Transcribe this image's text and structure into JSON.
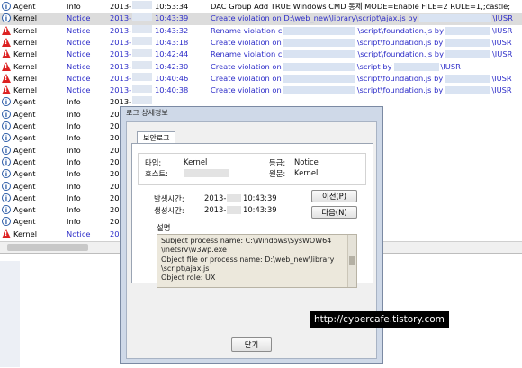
{
  "rows": [
    {
      "type": "info",
      "source": "Agent",
      "level": "Info",
      "date": "2013-",
      "time": "10:53:34",
      "desc": "DAC Group Add TRUE Windows CMD 통제 MODE=Enable FILE=2 RULE=1,;castle;",
      "sel": false
    },
    {
      "type": "info",
      "source": "Kernel",
      "level": "Notice",
      "date": "2013-",
      "time": "10:43:39",
      "desc": "Create violation on D:\\web_new\\library\\script\\ajax.js by",
      "tail": "\\IUSR",
      "sel": true
    },
    {
      "type": "warn",
      "source": "Kernel",
      "level": "Notice",
      "date": "2013-",
      "time": "10:43:32",
      "desc": "Rename violation c",
      "tail": "\\script\\foundation.js by",
      "tail2": "\\IUSR",
      "sel": false
    },
    {
      "type": "warn",
      "source": "Kernel",
      "level": "Notice",
      "date": "2013-",
      "time": "10:43:18",
      "desc": "Create violation on",
      "tail": "\\script\\foundation.js by",
      "tail2": "\\IUSR",
      "sel": false
    },
    {
      "type": "warn",
      "source": "Kernel",
      "level": "Notice",
      "date": "2013-",
      "time": "10:42:44",
      "desc": "Rename violation c",
      "tail": "\\script\\foundation.js by",
      "tail2": "\\IUSR",
      "sel": false
    },
    {
      "type": "warn",
      "source": "Kernel",
      "level": "Notice",
      "date": "2013-",
      "time": "10:42:30",
      "desc": "Create violation on",
      "tail": "\\script by",
      "tail2": "\\IUSR",
      "sel": false
    },
    {
      "type": "warn",
      "source": "Kernel",
      "level": "Notice",
      "date": "2013-",
      "time": "10:40:46",
      "desc": "Create violation on",
      "tail": "\\script\\foundation.js by",
      "tail2": "\\IUSR",
      "sel": false
    },
    {
      "type": "warn",
      "source": "Kernel",
      "level": "Notice",
      "date": "2013-",
      "time": "10:40:38",
      "desc": "Create violation on",
      "tail": "\\script\\foundation.js by",
      "tail2": "\\IUSR",
      "sel": false
    },
    {
      "type": "info",
      "source": "Agent",
      "level": "Info",
      "date": "2013-",
      "time": "",
      "desc": "",
      "sel": false
    },
    {
      "type": "info",
      "source": "Agent",
      "level": "Info",
      "date": "2013-",
      "time": "",
      "desc": "",
      "tail": "nged.",
      "sel": false
    },
    {
      "type": "info",
      "source": "Agent",
      "level": "Info",
      "date": "2013-",
      "time": "",
      "desc": "",
      "sel": false
    },
    {
      "type": "info",
      "source": "Agent",
      "level": "Info",
      "date": "2013-",
      "time": "",
      "desc": "",
      "sel": false
    },
    {
      "type": "info",
      "source": "Agent",
      "level": "Info",
      "date": "2013-",
      "time": "",
      "desc": "",
      "sel": false
    },
    {
      "type": "info",
      "source": "Agent",
      "level": "Info",
      "date": "2013-",
      "time": "",
      "desc": "",
      "sel": false
    },
    {
      "type": "info",
      "source": "Agent",
      "level": "Info",
      "date": "2013-",
      "time": "",
      "desc": "",
      "sel": false
    },
    {
      "type": "info",
      "source": "Agent",
      "level": "Info",
      "date": "2013-",
      "time": "",
      "desc": "",
      "sel": false
    },
    {
      "type": "info",
      "source": "Agent",
      "level": "Info",
      "date": "2013-",
      "time": "",
      "desc": "",
      "sel": false
    },
    {
      "type": "info",
      "source": "Agent",
      "level": "Info",
      "date": "2013-",
      "time": "",
      "desc": "",
      "sel": false
    },
    {
      "type": "info",
      "source": "Agent",
      "level": "Info",
      "date": "2013-",
      "time": "",
      "desc": "",
      "sel": false
    },
    {
      "type": "warn",
      "source": "Kernel",
      "level": "Notice",
      "date": "2013-",
      "time": "",
      "desc": "",
      "tail": "\\IUSR",
      "sel": false
    }
  ],
  "dialog": {
    "title": "로그 상세정보",
    "tab": "보안로그",
    "type_label": "타입:",
    "type_value": "Kernel",
    "grade_label": "등급:",
    "grade_value": "Notice",
    "host_label": "호스트:",
    "source_label": "원문:",
    "source_value": "Kernel",
    "occur_label": "발생시간:",
    "occur_date": "2013-",
    "occur_time": "10:43:39",
    "create_label": "생성시간:",
    "create_date": "2013-",
    "create_time": "10:43:39",
    "prev_button": "이전(P)",
    "next_button": "다음(N)",
    "desc_label": "설명",
    "desc_lines": [
      "Subject process name: C:\\Windows\\SysWOW64",
      "\\inetsrv\\w3wp.exe",
      "Object file or process name: D:\\web_new\\library",
      "\\script\\ajax.js",
      "Object role: UX"
    ],
    "close_button": "닫기"
  },
  "watermark": "http://cybercafe.tistory.com"
}
